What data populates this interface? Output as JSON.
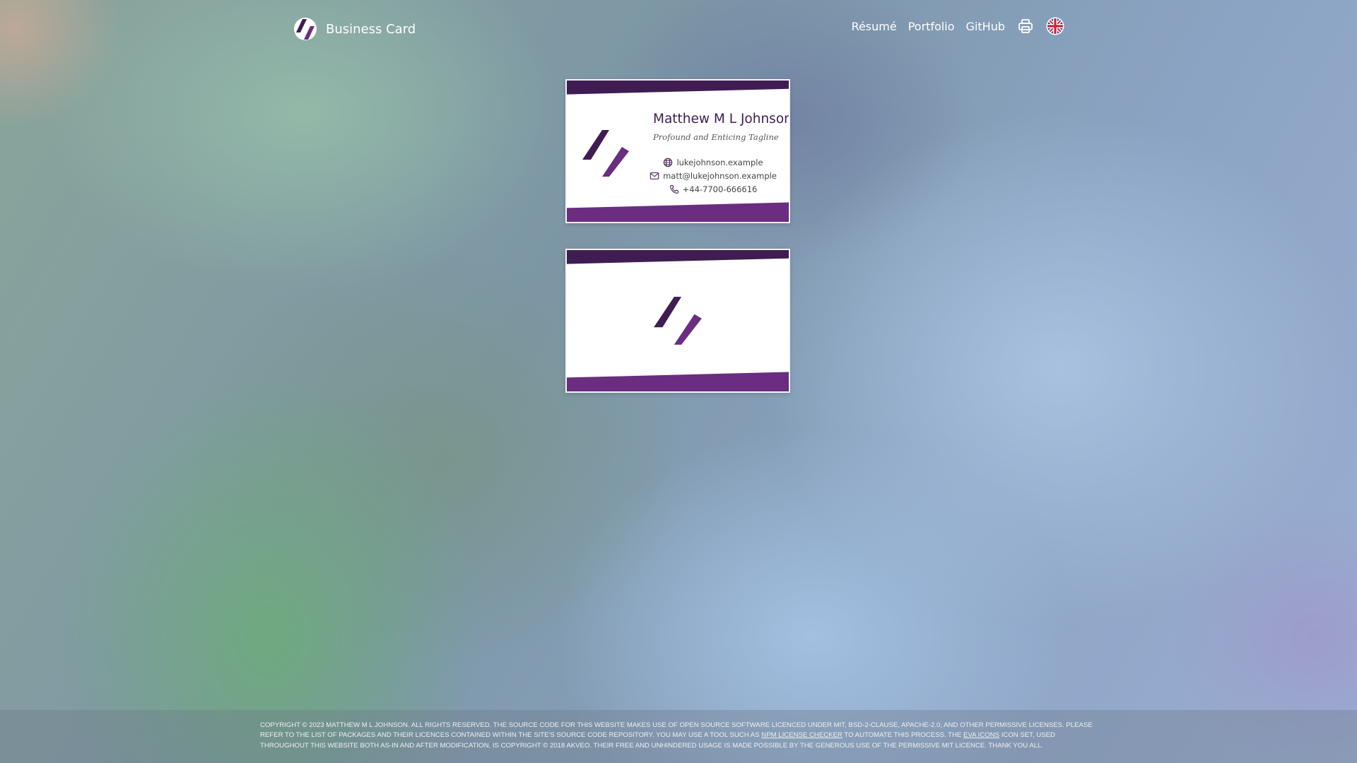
{
  "colors": {
    "brand_dark": "#3f1c52",
    "brand_light": "#6a2d80",
    "card_bg": "#ffffff",
    "nav_text": "#ffffff"
  },
  "header": {
    "brand_label": "Business Card",
    "brand_icon": "card-logo-icon",
    "nav": {
      "resume": "Résumé",
      "portfolio": "Portfolio",
      "github": "GitHub"
    },
    "print_icon": "printer-icon",
    "language_icon": "uk-flag-icon"
  },
  "card_front": {
    "name": "Matthew M L Johnson",
    "tagline": "Profound and Enticing Tagline",
    "website": "lukejohnson.example",
    "email": "matt@lukejohnson.example",
    "phone": "+44-7700-666616",
    "icons": {
      "website": "globe-icon",
      "email": "envelope-icon",
      "phone": "phone-icon"
    }
  },
  "footer": {
    "text_1": "Copyright © 2023 Matthew M L Johnson. All rights reserved. The source code for this website makes use of open source software licenced under MIT, BSD-2-Clause, Apache-2.0, and other permissive licenses. Please refer to the list of packages and their licences contained within the site's source code repository. You may use a tool such as ",
    "link_1": "npm license checker",
    "text_2": " to automate this process. The ",
    "link_2": "Eva Icons",
    "text_3": " icon set, used throughout this website both as-in and after modification, is copyright © 2018 Akveo. Their free and unhindered usage is made possible by the generous use of the permissive MIT licence. Thank you all."
  }
}
